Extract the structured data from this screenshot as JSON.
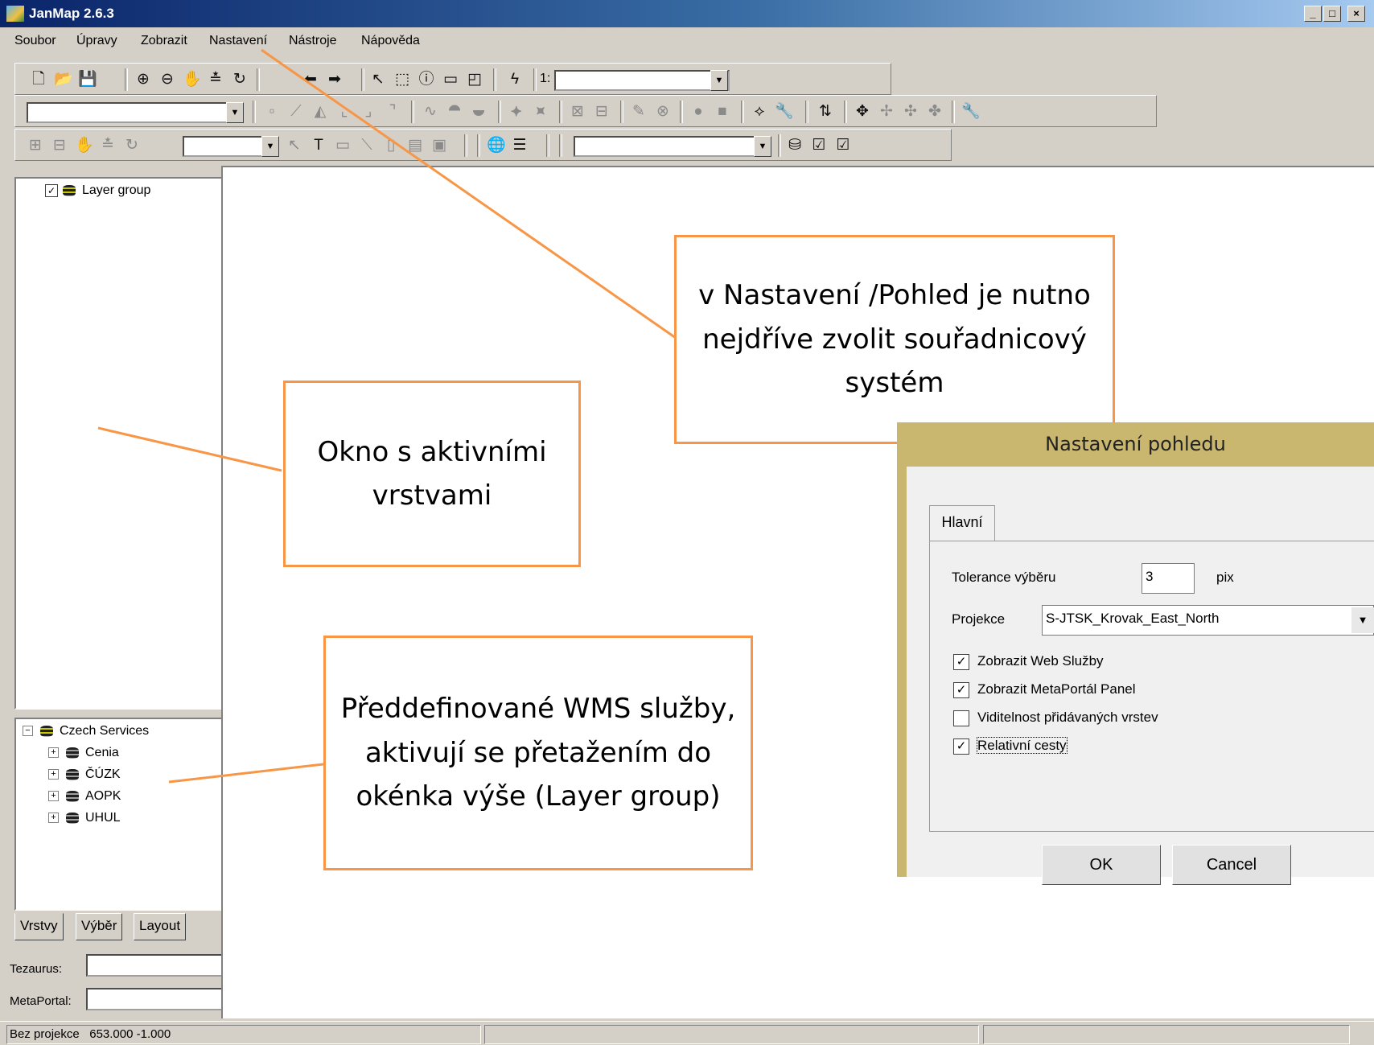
{
  "window": {
    "title": "JanMap 2.6.3",
    "minimize": "_",
    "maximize": "□",
    "close": "×"
  },
  "menu": [
    "Soubor",
    "Úpravy",
    "Zobrazit",
    "Nastavení",
    "Nástroje",
    "Nápověda"
  ],
  "toolbar": {
    "scale_prefix": "1:",
    "scale_value": ""
  },
  "layers": {
    "root": "Layer group"
  },
  "services": {
    "root": "Czech Services",
    "items": [
      "Cenia",
      "ČÚZK",
      "AOPK",
      "UHUL"
    ]
  },
  "tabs": [
    "Vrstvy",
    "Výběr",
    "Layout"
  ],
  "search": {
    "tezaurus_label": "Tezaurus:",
    "metaportal_label": "MetaPortal:"
  },
  "status": {
    "projection": "Bez projekce",
    "coords": "653.000  -1.000"
  },
  "callouts": {
    "settings": "v Nastavení /Pohled je nutno nejdříve zvolit souřadnicový systém",
    "layers": "Okno s aktivními vrstvami",
    "wms": "Předdefinované WMS služby, aktivují se přetažením do okénka výše (Layer group)"
  },
  "dialog": {
    "title": "Nastavení pohledu",
    "tab": "Hlavní",
    "tolerance_label": "Tolerance výběru",
    "tolerance_value": "3",
    "tolerance_unit": "pix",
    "projection_label": "Projekce",
    "projection_value": "S-JTSK_Krovak_East_North",
    "options": [
      {
        "label": "Zobrazit Web Služby",
        "checked": true
      },
      {
        "label": "Zobrazit MetaPortál Panel",
        "checked": true
      },
      {
        "label": "Viditelnost přidávaných vrstev",
        "checked": false
      },
      {
        "label": "Relativní cesty",
        "checked": true
      }
    ],
    "ok": "OK",
    "cancel": "Cancel"
  },
  "colors": {
    "callout_border": "#f79646",
    "titlebar_start": "#0a246a",
    "dialog_frame": "#c9b770"
  }
}
